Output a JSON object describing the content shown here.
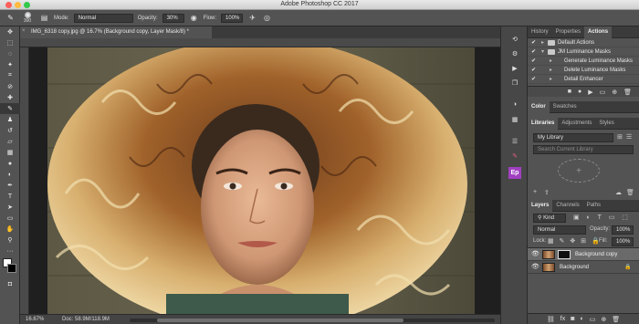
{
  "window": {
    "title": "Adobe Photoshop CC 2017",
    "traffic_colors": [
      "#fc605b",
      "#fdbc40",
      "#34c84a"
    ]
  },
  "options_bar": {
    "brush_size": "300",
    "mode_label": "Mode:",
    "mode_value": "Normal",
    "opacity_label": "Opacity:",
    "opacity_value": "30%",
    "flow_label": "Flow:",
    "flow_value": "100%"
  },
  "document": {
    "tab_title": "IMG_6318 copy.jpg @ 16.7% (Background copy, Layer Mask/8) *",
    "zoom": "16.67%",
    "doc_size": "Doc: 58.9M/118.9M"
  },
  "actions_panel": {
    "tabs": [
      "History",
      "Properties",
      "Actions"
    ],
    "active_tab": "Actions",
    "items": [
      {
        "label": "Default Actions",
        "checked": "✔",
        "indent": 0
      },
      {
        "label": "JM Luminance Masks",
        "checked": "✔",
        "indent": 0
      },
      {
        "label": "Generate Luminance Masks",
        "checked": "✔",
        "indent": 1
      },
      {
        "label": "Delete Luminance Masks",
        "checked": "✔",
        "indent": 1
      },
      {
        "label": "Detail Enhancer",
        "checked": "✔",
        "indent": 1
      }
    ]
  },
  "color_panel": {
    "tabs": [
      "Color",
      "Swatches"
    ],
    "active_tab": "Color"
  },
  "libraries_panel": {
    "tabs": [
      "Libraries",
      "Adjustments",
      "Styles"
    ],
    "active_tab": "Libraries",
    "library_name": "My Library",
    "search_placeholder": "Search Current Library"
  },
  "layers_panel": {
    "tabs": [
      "Layers",
      "Channels",
      "Paths"
    ],
    "active_tab": "Layers",
    "filter_label": "Kind",
    "blend_mode": "Normal",
    "opacity_label": "Opacity:",
    "opacity_value": "100%",
    "lock_label": "Lock:",
    "fill_label": "Fill:",
    "fill_value": "100%",
    "layers": [
      {
        "name": "Background copy",
        "selected": true,
        "has_mask": true
      },
      {
        "name": "Background",
        "selected": false,
        "has_mask": false
      }
    ]
  }
}
